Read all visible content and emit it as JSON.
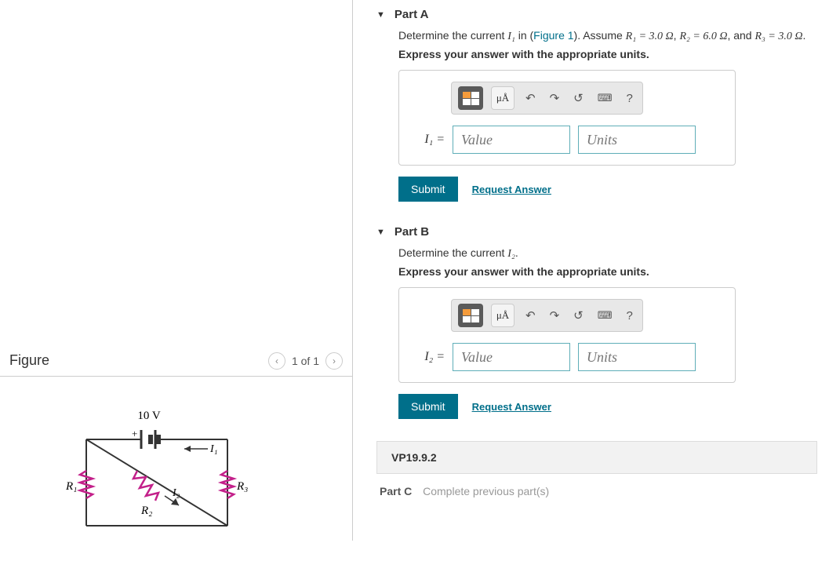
{
  "figure": {
    "title": "Figure",
    "pager": "1 of 1",
    "voltage_label": "10 V",
    "r1": "R₁",
    "r2": "R₂",
    "r3": "R₃",
    "i1": "I₁",
    "i2": "I₂",
    "plus": "+"
  },
  "partA": {
    "header": "Part A",
    "prompt_pre": "Determine the current ",
    "prompt_var": "I₁",
    "prompt_mid": " in (",
    "prompt_link": "Figure 1",
    "prompt_post": "). Assume ",
    "r1": "R₁ = 3.0 Ω",
    "sep1": ", ",
    "r2": "R₂ = 6.0 Ω",
    "sep2": ", and ",
    "r3": "R₃ = 3.0 Ω",
    "period": ".",
    "instruction": "Express your answer with the appropriate units.",
    "var_label": "I₁ =",
    "value_placeholder": "Value",
    "units_placeholder": "Units",
    "submit": "Submit",
    "request": "Request Answer",
    "mu_btn": "μÅ",
    "help_btn": "?"
  },
  "partB": {
    "header": "Part B",
    "prompt_pre": "Determine the current ",
    "prompt_var": "I₂",
    "prompt_post": ".",
    "instruction": "Express your answer with the appropriate units.",
    "var_label": "I₂ =",
    "value_placeholder": "Value",
    "units_placeholder": "Units",
    "submit": "Submit",
    "request": "Request Answer",
    "mu_btn": "μÅ",
    "help_btn": "?"
  },
  "vp_label": "VP19.9.2",
  "partC": {
    "label": "Part C",
    "text": "Complete previous part(s)"
  }
}
